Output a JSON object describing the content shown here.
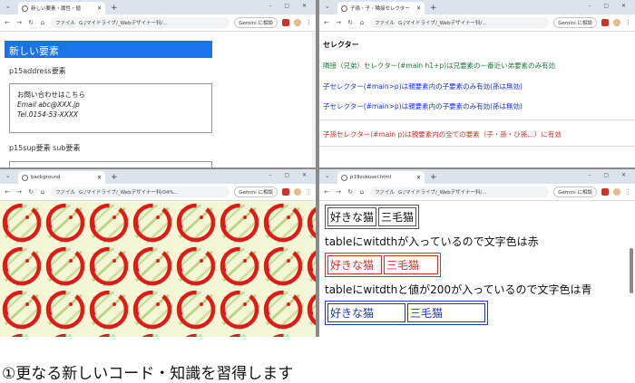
{
  "common": {
    "new_tab": "+",
    "win_controls": "– ▢ ✕",
    "tab_close": "✕",
    "file_label": "ファイル",
    "gemini": "Gemini に相談"
  },
  "w1": {
    "tab": "新しい要素・属性・値",
    "url": "G:/マイドライブ/_Webデザイナー科/...",
    "heading": "新しい要素",
    "p15address": "p15address要素",
    "addr_line1": "お問い合わせはこちら",
    "addr_line2": "Email abc@XXX.jp",
    "addr_line3": "Tel.0154-53-XXXX",
    "p15sup": "p15sup要素 sub要素"
  },
  "w2": {
    "tab": "子孫・子・隣接セレクター",
    "url": "G:/マイドライブ/_Webデザイナー科/...",
    "title": "セレクター",
    "line1": "隣接（兄弟）セレクター(#main h1+p)は兄要素の一番近い弟要素のみ有効",
    "line2": "子セレクター(#main>p)は親要素内の子要素のみ有効(孫は無効)",
    "line3": "子セレクター(#main>p)は親要素内の子要素のみ有効(孫は無効)",
    "line4": "子孫セレクター(#main p)は親要素内の全ての要素（子・孫・ひ孫…）に有効"
  },
  "w3": {
    "tab": "background",
    "url": "G:/マイドライブ/_Webデザイナー科/04%..."
  },
  "w4": {
    "tab": "p19zokusei.html",
    "url": "G:/マイドライブ/_Webデザイナー科/...",
    "t1_c1": "好きな猫",
    "t1_c2": "三毛猫",
    "para1": "tableにwitdthが入っているので文字色は赤",
    "t2_c1": "好きな猫",
    "t2_c2": "三毛猫",
    "para2": "tableにwitdthと値が200が入っているので文字色は青",
    "t3_c1": "好きな猫",
    "t3_c2": "三毛猫"
  },
  "caption": "①更なる新しいコード・知識を習得します",
  "colors": {
    "accent_blue": "#1a73e8",
    "text_green": "#188038",
    "text_blue": "#1a34d8",
    "text_red": "#d93025"
  }
}
